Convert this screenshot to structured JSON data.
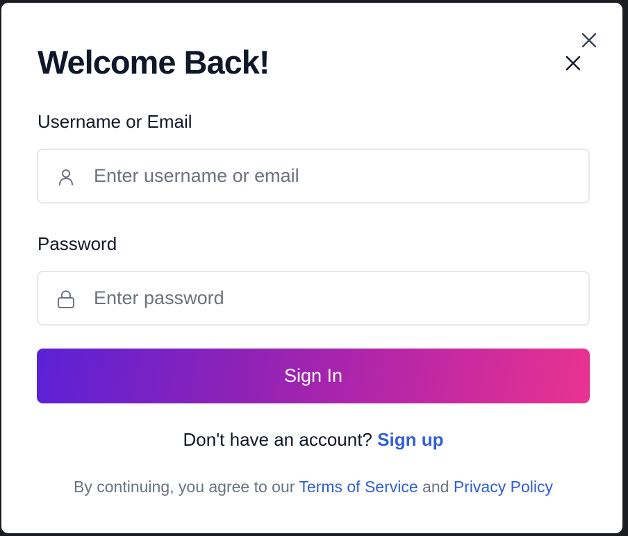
{
  "modal": {
    "title": "Welcome Back!",
    "close_icon": "close-icon"
  },
  "username_field": {
    "label": "Username or Email",
    "placeholder": "Enter username or email",
    "value": "",
    "icon": "user-icon"
  },
  "password_field": {
    "label": "Password",
    "placeholder": "Enter password",
    "value": "",
    "icon": "lock-icon"
  },
  "signin_button": {
    "label": "Sign In"
  },
  "signup_prompt": {
    "text": "Don't have an account?",
    "link": "Sign up"
  },
  "legal": {
    "prefix": "By continuing, you agree to our",
    "terms_link": "Terms of Service",
    "conjunction": "and",
    "privacy_link": "Privacy Policy"
  },
  "colors": {
    "link": "#2f5fd7",
    "gradient_start": "#5b21d6",
    "gradient_end": "#ea3390",
    "title": "#0f172a"
  }
}
